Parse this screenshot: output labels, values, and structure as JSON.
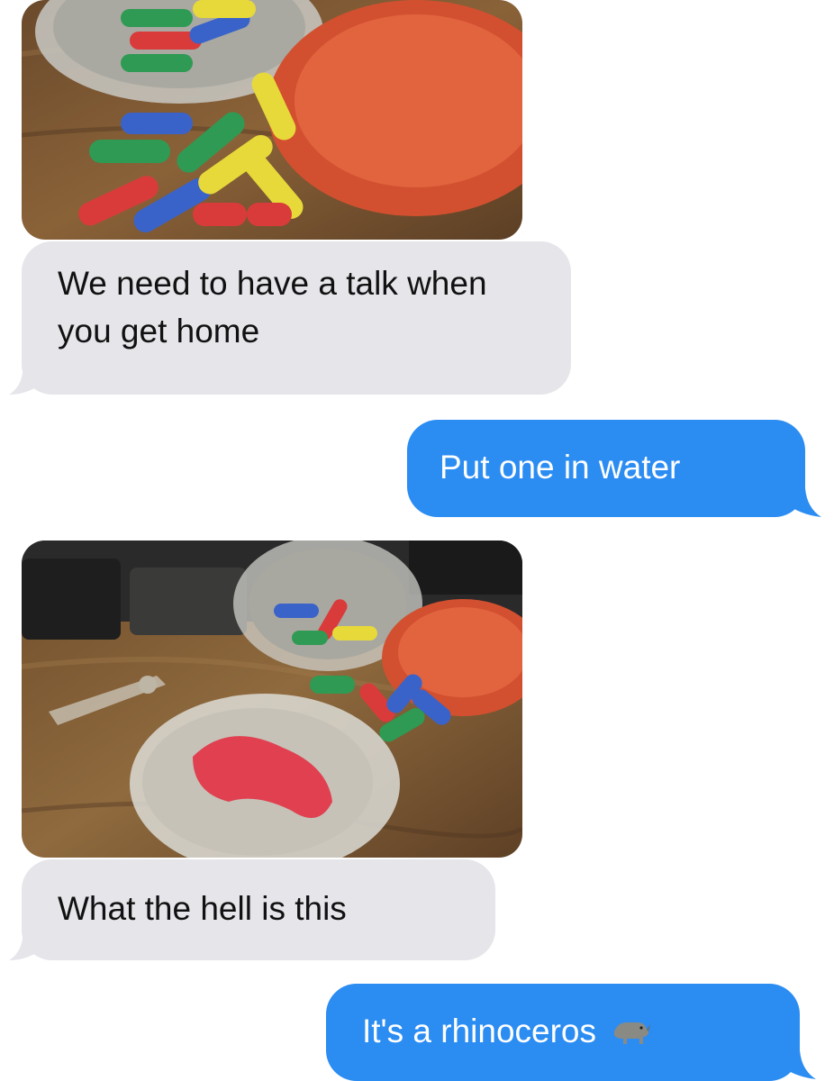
{
  "conversation": {
    "messages": [
      {
        "sender": "them",
        "type": "image",
        "alt": "Colorful capsules scattered next to a clear bowl and an orange lid on a wooden table"
      },
      {
        "sender": "them",
        "type": "text",
        "text": "We need to have a talk when you get home"
      },
      {
        "sender": "me",
        "type": "text",
        "text": "Put one in water"
      },
      {
        "sender": "them",
        "type": "image",
        "alt": "Clear bowl of water with a red sponge shape, capsules and a bowl on a wooden table"
      },
      {
        "sender": "them",
        "type": "text",
        "text": "What the hell is this"
      },
      {
        "sender": "me",
        "type": "text",
        "text": "It's a rhinoceros",
        "emoji": "rhinoceros-emoji"
      }
    ]
  },
  "colors": {
    "incoming_bubble": "#e5e5ea",
    "outgoing_bubble": "#2b8cf2",
    "incoming_text": "#111111",
    "outgoing_text": "#ffffff",
    "background": "#ffffff"
  }
}
